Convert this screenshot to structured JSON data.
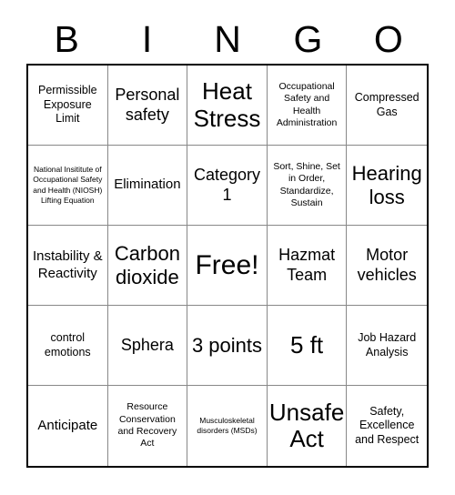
{
  "header": {
    "letters": [
      "B",
      "I",
      "N",
      "G",
      "O"
    ]
  },
  "grid": {
    "rows": 5,
    "columns": 5,
    "cells": [
      {
        "text": "Permissible Exposure Limit",
        "size": "fs-m"
      },
      {
        "text": "Personal safety",
        "size": "fs-xl"
      },
      {
        "text": "Heat Stress",
        "size": "fs-hu"
      },
      {
        "text": "Occupational Safety and Health Administration",
        "size": "fs-s"
      },
      {
        "text": "Compressed Gas",
        "size": "fs-m"
      },
      {
        "text": "National Insititute of Occupational Safety and Health (NIOSH) Lifting Equation",
        "size": "fs-xs"
      },
      {
        "text": "Elimination",
        "size": "fs-l"
      },
      {
        "text": "Category 1",
        "size": "fs-xl"
      },
      {
        "text": "Sort, Shine, Set in Order, Standardize, Sustain",
        "size": "fs-s"
      },
      {
        "text": "Hearing loss",
        "size": "fs-xxl"
      },
      {
        "text": "Instability & Reactivity",
        "size": "fs-l"
      },
      {
        "text": "Carbon dioxide",
        "size": "fs-xxl"
      },
      {
        "text": "Free!",
        "size": "fs-free"
      },
      {
        "text": "Hazmat Team",
        "size": "fs-xl"
      },
      {
        "text": "Motor vehicles",
        "size": "fs-xl"
      },
      {
        "text": "control emotions",
        "size": "fs-m"
      },
      {
        "text": "Sphera",
        "size": "fs-xl"
      },
      {
        "text": "3 points",
        "size": "fs-xxl"
      },
      {
        "text": "5 ft",
        "size": "fs-hu"
      },
      {
        "text": "Job Hazard Analysis",
        "size": "fs-m"
      },
      {
        "text": "Anticipate",
        "size": "fs-l"
      },
      {
        "text": "Resource Conservation and Recovery Act",
        "size": "fs-s"
      },
      {
        "text": "Musculoskeletal disorders (MSDs)",
        "size": "fs-xs"
      },
      {
        "text": "Unsafe Act",
        "size": "fs-hu"
      },
      {
        "text": "Safety, Excellence and Respect",
        "size": "fs-m"
      }
    ]
  },
  "colors": {
    "text": "#000000",
    "background": "#ffffff",
    "outer_border": "#000000",
    "inner_grid_line": "#888888"
  }
}
